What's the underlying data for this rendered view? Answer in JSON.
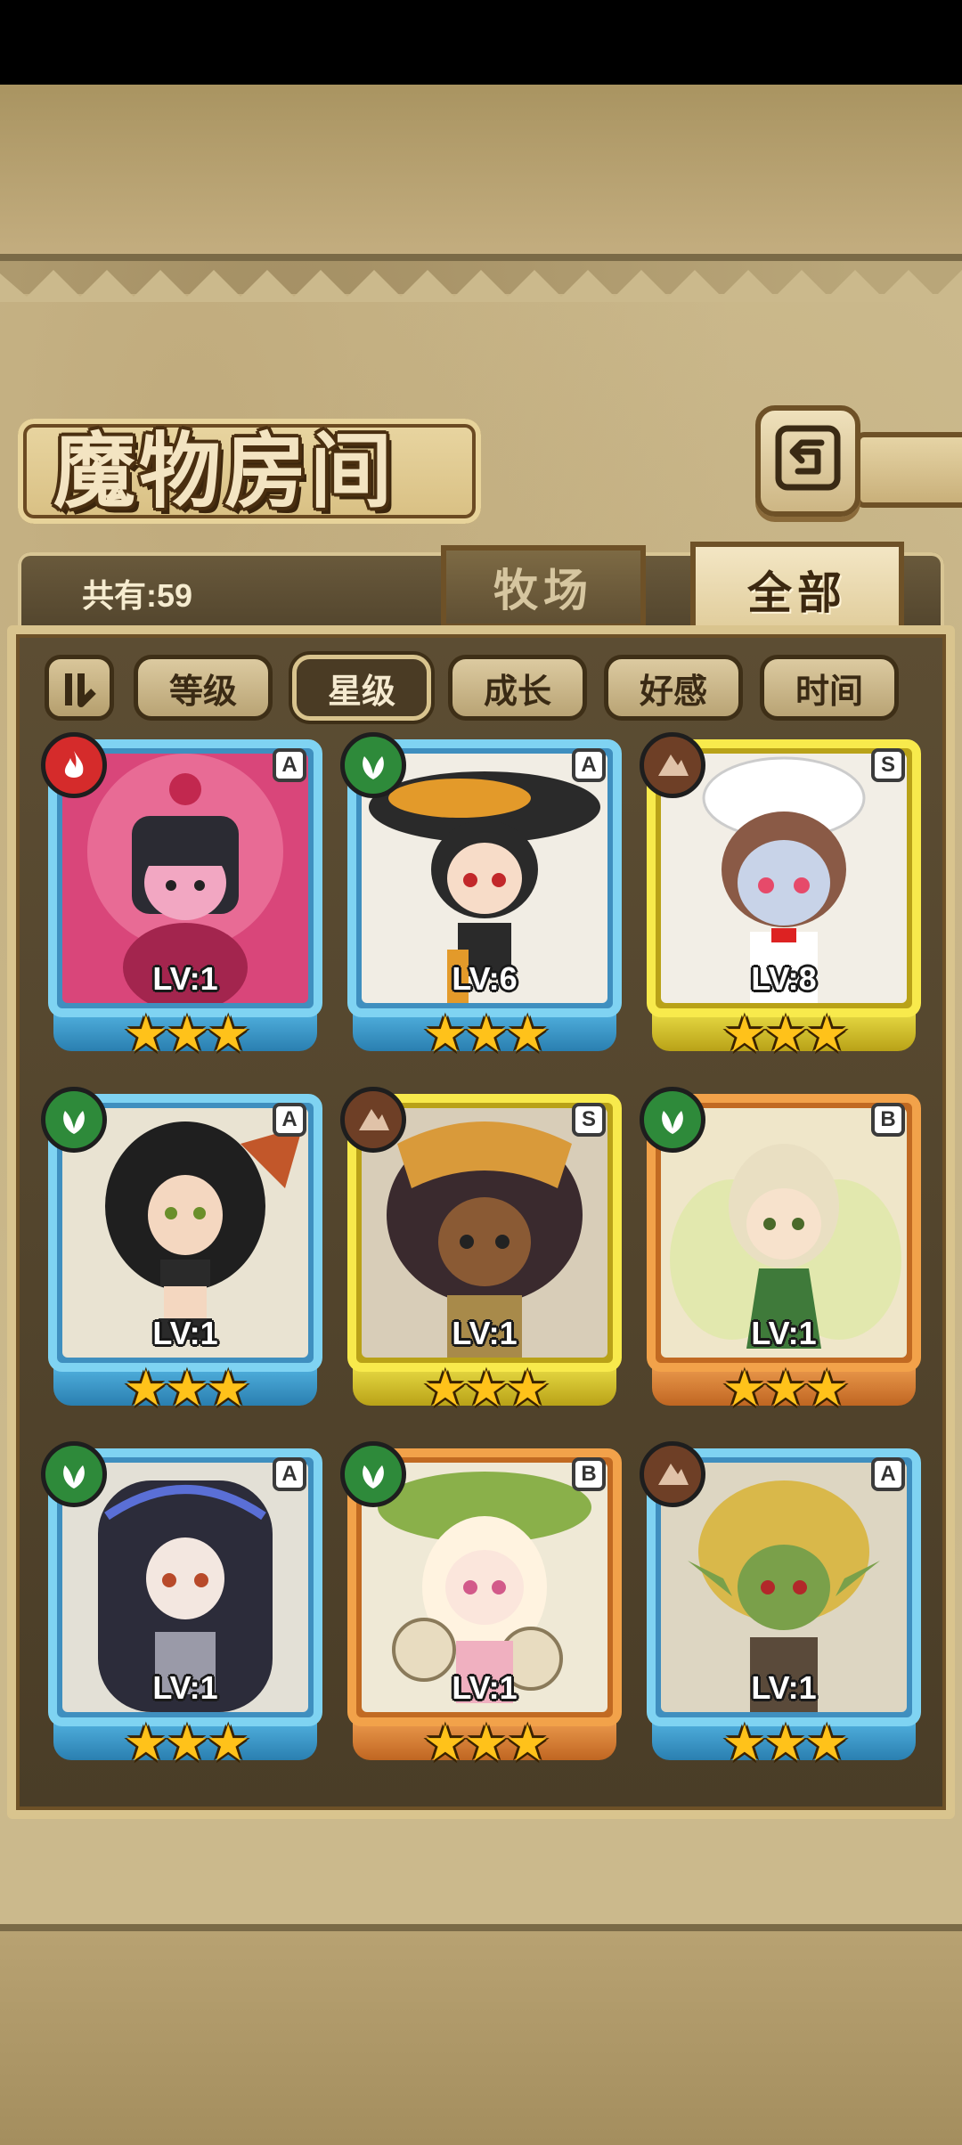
{
  "title": "魔物房间",
  "count_label": "共有:59",
  "tabs": [
    {
      "label": "牧场",
      "active": false
    },
    {
      "label": "全部",
      "active": true
    }
  ],
  "sort_options": [
    {
      "label": "等级",
      "active": false
    },
    {
      "label": "星级",
      "active": true
    },
    {
      "label": "成长",
      "active": false
    },
    {
      "label": "好感",
      "active": false
    },
    {
      "label": "时间",
      "active": false
    }
  ],
  "icons": {
    "back": "back-arrow-icon",
    "sort_toggle": "sort-direction-icon"
  },
  "colors": {
    "rank_A_frame": "#7fd3f2",
    "rank_S_frame": "#f8ea4c",
    "rank_B_frame": "#f2a24a",
    "fire": "#d52b2b",
    "nature": "#2e8a3a",
    "earth": "#6e3f26"
  },
  "monsters": [
    {
      "rank": "A",
      "element": "fire",
      "level": "LV:1",
      "stars": "★★★",
      "stars_count": 3
    },
    {
      "rank": "A",
      "element": "nature",
      "level": "LV:6",
      "stars": "★★★",
      "stars_count": 3
    },
    {
      "rank": "S",
      "element": "earth",
      "level": "LV:8",
      "stars": "★★★",
      "stars_count": 3
    },
    {
      "rank": "A",
      "element": "nature",
      "level": "LV:1",
      "stars": "★★★",
      "stars_count": 3
    },
    {
      "rank": "S",
      "element": "earth",
      "level": "LV:1",
      "stars": "★★★",
      "stars_count": 3
    },
    {
      "rank": "B",
      "element": "nature",
      "level": "LV:1",
      "stars": "★★★",
      "stars_count": 3
    },
    {
      "rank": "A",
      "element": "nature",
      "level": "LV:1",
      "stars": "★★★",
      "stars_count": 3
    },
    {
      "rank": "B",
      "element": "nature",
      "level": "LV:1",
      "stars": "★★★",
      "stars_count": 3
    },
    {
      "rank": "A",
      "element": "earth",
      "level": "LV:1",
      "stars": "★★★",
      "stars_count": 3
    }
  ]
}
